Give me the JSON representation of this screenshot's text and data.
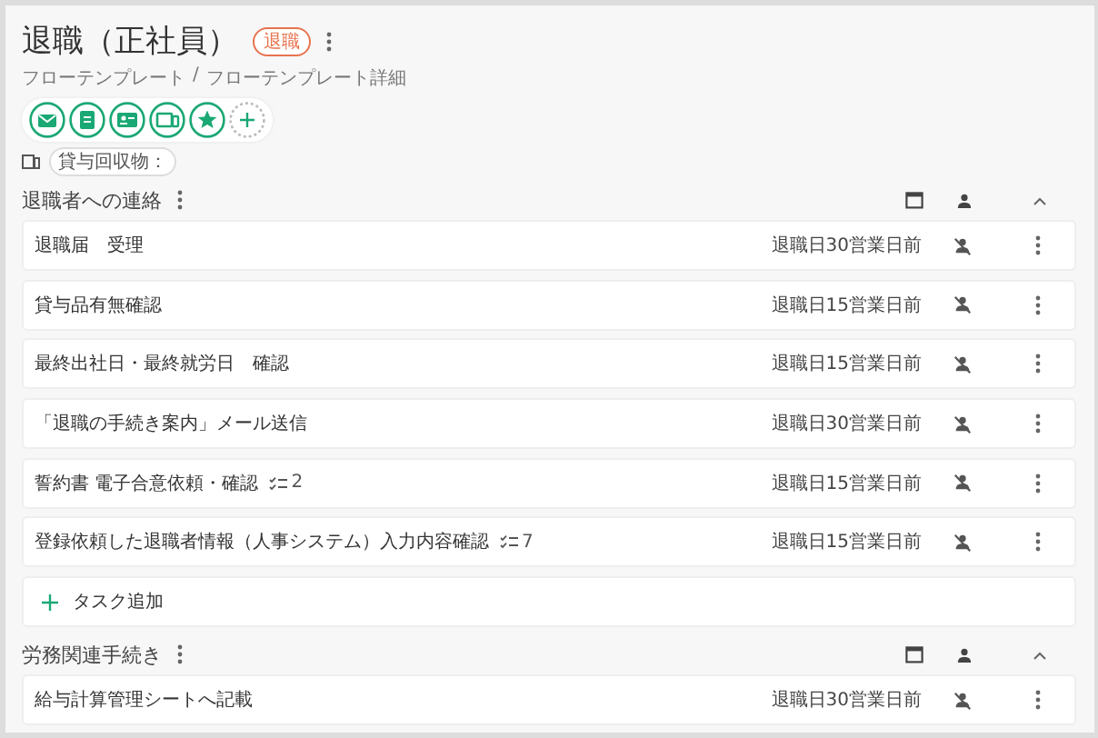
{
  "title": "退職（正社員）",
  "status_badge": "退職",
  "breadcrumb_separator": "/",
  "breadcrumb": [
    {
      "label": "フローテンプレート"
    },
    {
      "label": "フローテンプレート詳細"
    }
  ],
  "action_icons": [
    {
      "kind": "mail"
    },
    {
      "kind": "document"
    },
    {
      "kind": "id-card"
    },
    {
      "kind": "device"
    },
    {
      "kind": "star"
    },
    {
      "kind": "add"
    }
  ],
  "tag": "貸与回収物：",
  "sections": [
    {
      "title": "退職者への連絡",
      "expanded": true,
      "add_task_label": "タスク追加",
      "tasks": [
        {
          "label": "退職届　受理",
          "deadline": "退職日30営業日前"
        },
        {
          "label": "貸与品有無確認",
          "deadline": "退職日15営業日前"
        },
        {
          "label": "最終出社日・最終就労日　確認",
          "deadline": "退職日15営業日前"
        },
        {
          "label": "「退職の手続き案内」メール送信",
          "deadline": "退職日30営業日前"
        },
        {
          "label": "誓約書 電子合意依頼・確認",
          "checklist_count": "2",
          "deadline": "退職日15営業日前"
        },
        {
          "label": "登録依頼した退職者情報（人事システム）入力内容確認",
          "checklist_count": "7",
          "deadline": "退職日15営業日前"
        }
      ]
    },
    {
      "title": "労務関連手続き",
      "expanded": true,
      "tasks": [
        {
          "label": "給与計算管理シートへ記載",
          "deadline": "退職日30営業日前"
        }
      ]
    }
  ]
}
